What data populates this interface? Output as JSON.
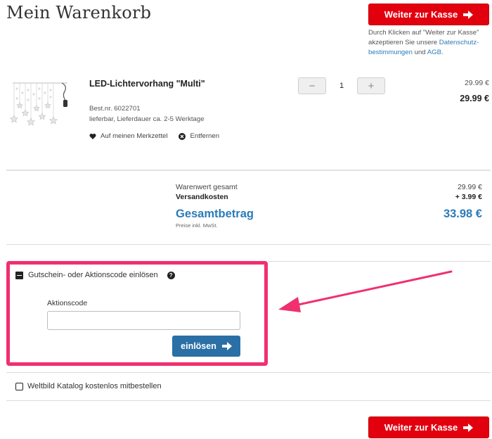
{
  "page": {
    "title": "Mein Warenkorb"
  },
  "checkout": {
    "button_label": "Weiter zur Kasse",
    "consent": {
      "prefix": "Durch Klicken auf \"Weiter zur Kasse\" akzeptieren Sie unsere ",
      "link_privacy": "Datenschutz-bestimmungen",
      "and": " und ",
      "link_terms": "AGB",
      "suffix": "."
    }
  },
  "item": {
    "name": "LED-Lichtervorhang \"Multi\"",
    "order_number": "Best.nr. 6022701",
    "availability": "lieferbar, Lieferdauer ca. 2-5 Werktage",
    "wishlist_label": "Auf meinen Merkzettel",
    "remove_label": "Entfernen",
    "quantity": "1",
    "qty_minus": "−",
    "qty_plus": "+",
    "unit_price": "29.99 €",
    "total_price": "29.99 €"
  },
  "totals": {
    "goods_label": "Warenwert gesamt",
    "goods_value": "29.99 €",
    "shipping_label": "Versandkosten",
    "shipping_value": "+ 3.99 €",
    "grand_label": "Gesamtbetrag",
    "grand_value": "33.98 €",
    "note": "Preise inkl. MwSt."
  },
  "coupon": {
    "header": "Gutschein- oder Aktionscode einlösen",
    "help": "?",
    "field_label": "Aktionscode",
    "field_value": "",
    "field_placeholder": "",
    "redeem_label": "einlösen"
  },
  "catalog": {
    "label": "Weltbild Katalog kostenlos mitbestellen"
  },
  "colors": {
    "brand_red": "#e2000f",
    "link_blue": "#2b7bb9",
    "redeem_blue": "#2a6fa5",
    "highlight_pink": "#f0306f"
  },
  "icons": {
    "arrow": "arrow-right-icon",
    "heart": "heart-icon",
    "remove": "remove-icon",
    "help": "help-icon"
  }
}
